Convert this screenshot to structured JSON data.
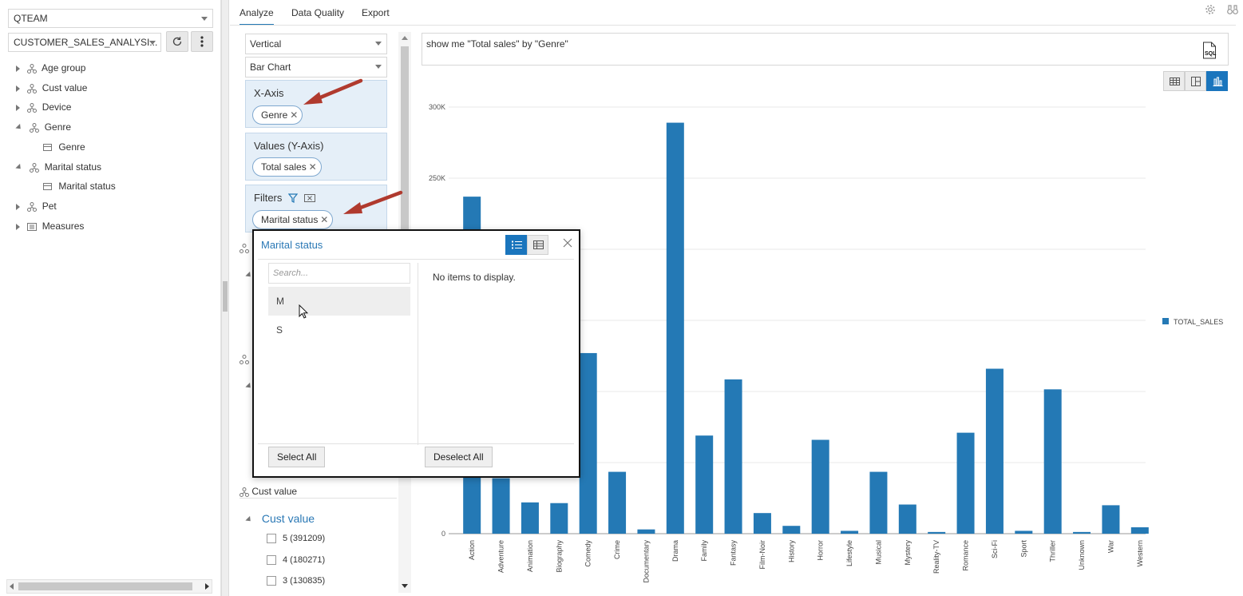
{
  "left_panel": {
    "schema_select": "QTEAM",
    "dataset_select": "CUSTOMER_SALES_ANALYSI...",
    "tree": [
      {
        "label": "Age group",
        "type": "hierarchy",
        "expanded": false
      },
      {
        "label": "Cust value",
        "type": "hierarchy",
        "expanded": false
      },
      {
        "label": "Device",
        "type": "hierarchy",
        "expanded": false
      },
      {
        "label": "Genre",
        "type": "hierarchy",
        "expanded": true
      },
      {
        "label": "Genre",
        "type": "level"
      },
      {
        "label": "Marital status",
        "type": "hierarchy",
        "expanded": true
      },
      {
        "label": "Marital status",
        "type": "level"
      },
      {
        "label": "Pet",
        "type": "hierarchy",
        "expanded": false
      },
      {
        "label": "Measures",
        "type": "measures",
        "expanded": false
      }
    ]
  },
  "tabs": [
    {
      "label": "Analyze",
      "active": true
    },
    {
      "label": "Data Quality",
      "active": false
    },
    {
      "label": "Export",
      "active": false
    }
  ],
  "config": {
    "orientation": "Vertical",
    "chart_type": "Bar Chart",
    "x_axis": {
      "title": "X-Axis",
      "pill": "Genre"
    },
    "values": {
      "title": "Values (Y-Axis)",
      "pill": "Total sales"
    },
    "filters": {
      "title": "Filters",
      "pill": "Marital status"
    },
    "cust_value_heading": "Cust value",
    "cust_value_group": "Cust value",
    "cust_value_options": [
      "5 (391209)",
      "4 (180271)",
      "3 (130835)"
    ]
  },
  "query": "show me \"Total sales\" by \"Genre\"",
  "sql_icon_label": "SQL",
  "popup": {
    "title": "Marital status",
    "search_placeholder": "Search...",
    "items": [
      "M",
      "S"
    ],
    "empty_text": "No items to display.",
    "select_all": "Select All",
    "deselect_all": "Deselect All"
  },
  "colors": {
    "accent": "#1a75bd",
    "bar": "#2479b5",
    "annotation_arrow": "#b03a2e"
  },
  "chart_data": {
    "type": "bar",
    "categories": [
      "Action",
      "Adventure",
      "Animation",
      "Biography",
      "Comedy",
      "Crime",
      "Documentary",
      "Drama",
      "Family",
      "Fantasy",
      "Film-Noir",
      "History",
      "Horror",
      "Lifestyle",
      "Musical",
      "Mystery",
      "Reality-TV",
      "Romance",
      "Sci-Fi",
      "Sport",
      "Thriller",
      "Unknown",
      "War",
      "Western"
    ],
    "series": [
      {
        "name": "TOTAL_SALES",
        "values": [
          237000,
          39000,
          22000,
          21500,
          127000,
          43500,
          3000,
          289000,
          69000,
          108500,
          14500,
          5500,
          66000,
          2000,
          43500,
          20500,
          1200,
          71000,
          116000,
          2000,
          101500,
          1200,
          20000,
          4500
        ]
      }
    ],
    "ylim": [
      0,
      300000
    ],
    "yticks": [
      0,
      250000,
      300000
    ],
    "ytick_labels": [
      "0",
      "250K",
      "300K"
    ],
    "grid": true,
    "legend": "right"
  }
}
